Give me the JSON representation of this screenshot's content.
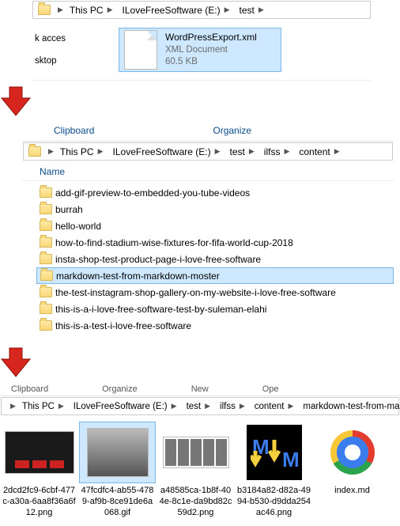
{
  "section1": {
    "breadcrumb": [
      "This PC",
      "ILoveFreeSoftware (E:)",
      "test"
    ],
    "leftRail": [
      "k acces",
      "sktop"
    ],
    "file": {
      "name": "WordPressExport.xml",
      "type": "XML Document",
      "size": "60.5 KB"
    }
  },
  "section2": {
    "tabs": [
      "Clipboard",
      "Organize"
    ],
    "breadcrumb": [
      "This PC",
      "ILoveFreeSoftware (E:)",
      "test",
      "ilfss",
      "content"
    ],
    "columnHeader": "Name",
    "folders": [
      "add-gif-preview-to-embedded-you-tube-videos",
      "burrah",
      "hello-world",
      "how-to-find-stadium-wise-fixtures-for-fifa-world-cup-2018",
      "insta-shop-test-product-page-i-love-free-software",
      "markdown-test-from-markdown-moster",
      "the-test-instagram-shop-gallery-on-my-website-i-love-free-software",
      "this-is-a-i-love-free-software-test-by-suleman-elahi",
      "this-is-a-test-i-love-free-software"
    ],
    "selectedIndex": 5
  },
  "section3": {
    "ribbon": [
      "Clipboard",
      "Organize",
      "New",
      "Ope"
    ],
    "breadcrumb": [
      "This PC",
      "ILoveFreeSoftware (E:)",
      "test",
      "ilfss",
      "content",
      "markdown-test-from-markdown-"
    ],
    "thumbs": [
      {
        "name": "2dcd2fc9-6cbf-477c-a30a-6aa8f36a6f12.png",
        "kind": "dark"
      },
      {
        "name": "47fcdfc4-ab55-4789-af9b-8ce91de6a068.gif",
        "kind": "gray",
        "selected": true
      },
      {
        "name": "a48585ca-1b8f-404e-8c1e-da9bd82c59d2.png",
        "kind": "strip"
      },
      {
        "name": "b3184a82-d82a-4994-b530-d9dda254ac46.png",
        "kind": "md"
      },
      {
        "name": "index.md",
        "kind": "chrome"
      }
    ]
  }
}
